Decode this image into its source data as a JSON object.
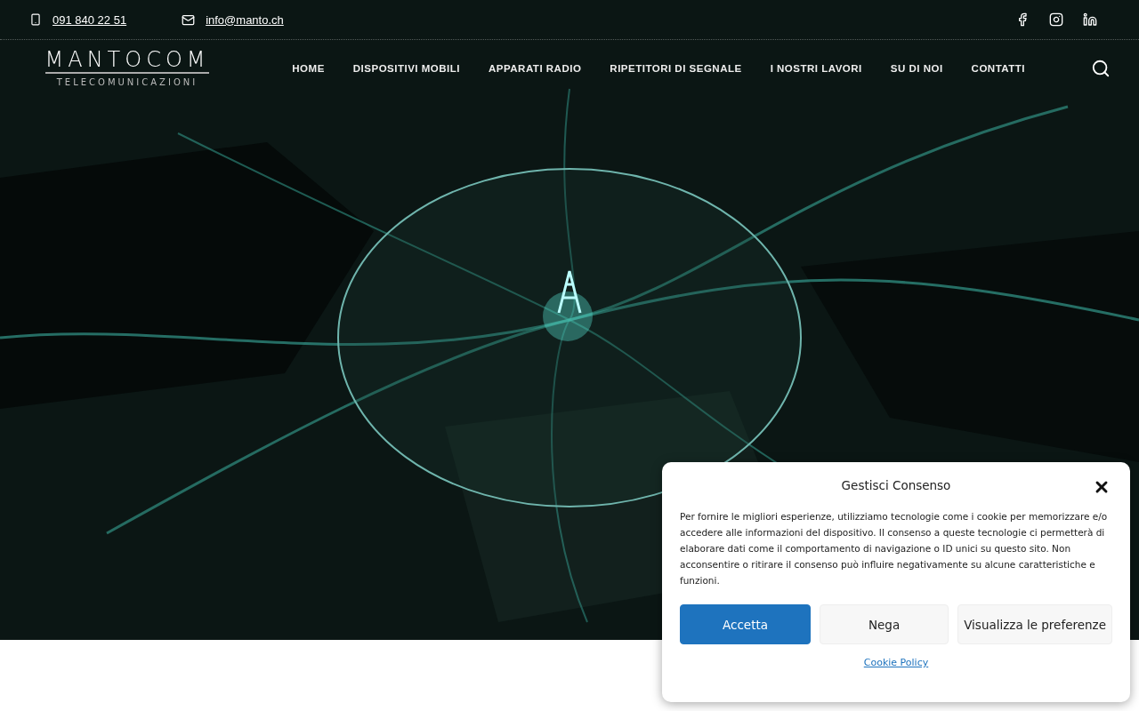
{
  "topbar": {
    "phone": "091 840 22 51",
    "email": "info@manto.ch"
  },
  "logo": {
    "name": "MANTOCOM",
    "tagline": "TELECOMUNICAZIONI"
  },
  "nav": [
    "HOME",
    "DISPOSITIVI MOBILI",
    "APPARATI RADIO",
    "RIPETITORI DI SEGNALE",
    "I NOSTRI LAVORI",
    "SU DI NOI",
    "CONTATTI"
  ],
  "cookie_dialog": {
    "title": "Gestisci Consenso",
    "text": "Per fornire le migliori esperienze, utilizziamo tecnologie come i cookie per memorizzare e/o accedere alle informazioni del dispositivo. Il consenso a queste tecnologie ci permetterà di elaborare dati come il comportamento di navigazione o ID unici su questo sito. Non acconsentire o ritirare il consenso può influire negativamente su alcune caratteristiche e funzioni.",
    "buttons": [
      {
        "label": "Accetta",
        "kind": "primary"
      },
      {
        "label": "Nega",
        "kind": "secondary"
      },
      {
        "label": "Visualizza le preferenze",
        "kind": "secondary"
      }
    ],
    "link": "Cookie Policy"
  }
}
